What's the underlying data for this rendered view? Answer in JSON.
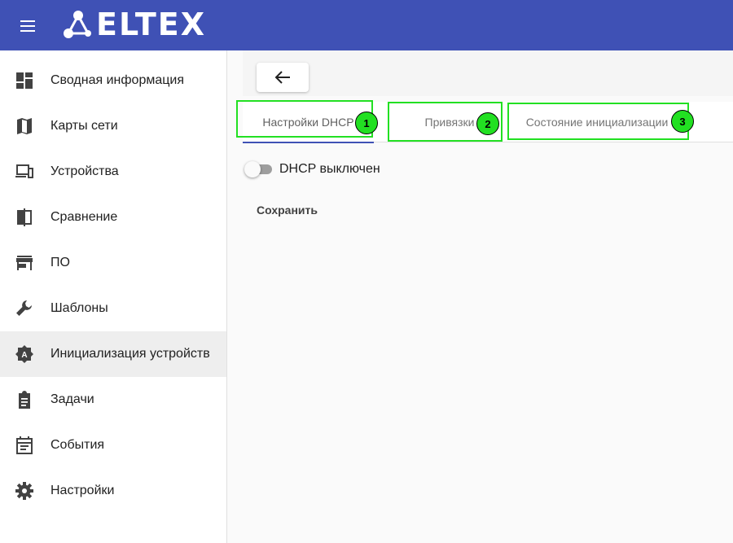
{
  "header": {
    "menu_icon": "hamburger-menu-icon",
    "logo_text": "ELTEX",
    "brand_color": "#3f51b5"
  },
  "sidebar": {
    "items": [
      {
        "label": "Сводная информация",
        "icon": "dashboard-icon"
      },
      {
        "label": "Карты сети",
        "icon": "map-icon"
      },
      {
        "label": "Устройства",
        "icon": "devices-icon"
      },
      {
        "label": "Сравнение",
        "icon": "compare-icon"
      },
      {
        "label": "ПО",
        "icon": "store-icon"
      },
      {
        "label": "Шаблоны",
        "icon": "wrench-icon"
      },
      {
        "label": "Инициализация устройств",
        "icon": "auto-init-icon",
        "active": true
      },
      {
        "label": "Задачи",
        "icon": "clipboard-icon"
      },
      {
        "label": "События",
        "icon": "calendar-icon"
      },
      {
        "label": "Настройки",
        "icon": "gear-icon"
      }
    ]
  },
  "main": {
    "back_icon": "arrow-left-icon",
    "tabs": [
      {
        "label": "Настройки DHCP",
        "active": true,
        "badge": "1"
      },
      {
        "label": "Привязки",
        "badge": "2"
      },
      {
        "label": "Состояние инициализации",
        "badge": "3"
      }
    ],
    "dhcp_toggle": {
      "label": "DHCP выключен",
      "on": false
    },
    "save_label": "Сохранить",
    "callout_color": "#22e022"
  }
}
